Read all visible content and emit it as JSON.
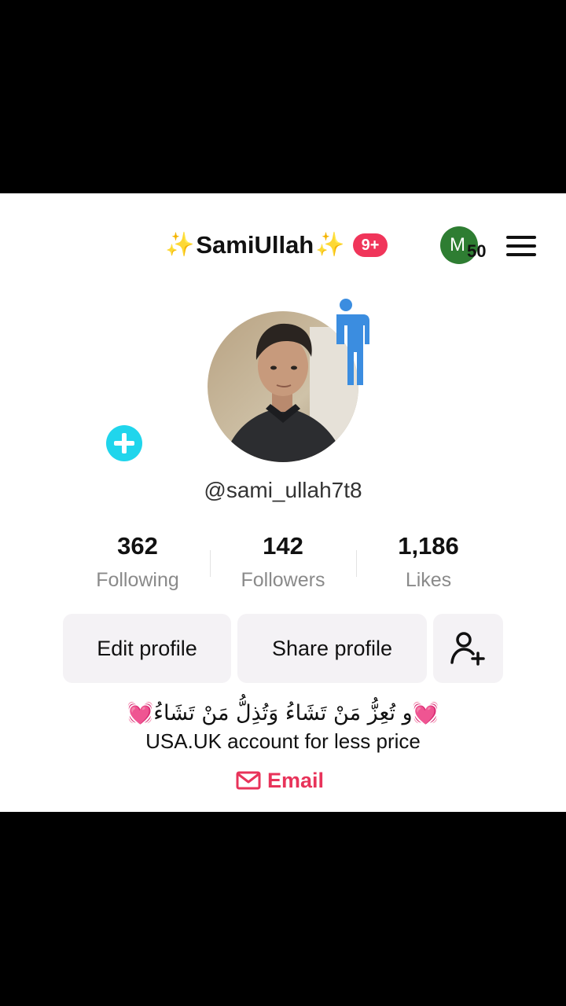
{
  "header": {
    "sparkle_left": "✨",
    "display_name": "SamiUllah",
    "sparkle_right": "✨",
    "notification_badge": "9+",
    "coin_letter": "M",
    "coin_count": "50",
    "menu_icon": "hamburger-menu-icon"
  },
  "profile": {
    "username": "@sami_ullah7t8",
    "avatar_add_icon": "plus-icon"
  },
  "stats": [
    {
      "value": "362",
      "label": "Following"
    },
    {
      "value": "142",
      "label": "Followers"
    },
    {
      "value": "1,186",
      "label": "Likes"
    }
  ],
  "actions": {
    "edit_profile": "Edit profile",
    "share_profile": "Share profile",
    "add_friend_icon": "add-friend-icon"
  },
  "bio": {
    "arabic_line": "💓و تُعِزُّ مَنْ تَشَاءُ وَتُذِلُّ مَنْ تَشَاءُ💓",
    "text_line": "USA.UK account for less price"
  },
  "email": {
    "label": "Email",
    "icon": "mail-icon"
  },
  "colors": {
    "accent_red": "#f0355a",
    "email_pink": "#e8335a",
    "avatar_add_cyan": "#20d5ec",
    "coin_green": "#2e7d32",
    "button_bg": "#f4f2f5"
  }
}
